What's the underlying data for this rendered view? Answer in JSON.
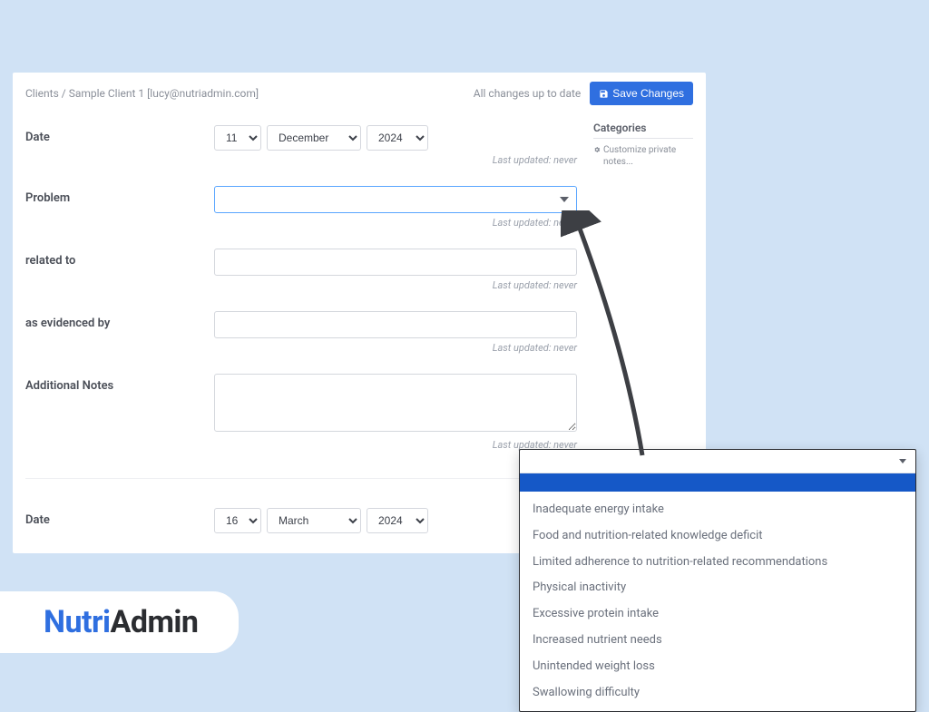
{
  "breadcrumb": {
    "root": "Clients",
    "sep": "/",
    "client": "Sample Client 1 [lucy@nutriadmin.com]"
  },
  "status": "All changes up to date",
  "save_label": "Save Changes",
  "sidebar": {
    "title": "Categories",
    "link": "Customize private notes..."
  },
  "fields": {
    "date1": {
      "label": "Date",
      "day": "11",
      "month": "December",
      "year": "2024",
      "updated": "Last updated: never"
    },
    "problem": {
      "label": "Problem",
      "value": "",
      "updated": "Last updated: never"
    },
    "related": {
      "label": "related to",
      "value": "",
      "updated": "Last updated: never"
    },
    "evidenced": {
      "label": "as evidenced by",
      "value": "",
      "updated": "Last updated: never"
    },
    "notes": {
      "label": "Additional Notes",
      "value": "",
      "updated": "Last updated: never"
    },
    "date2": {
      "label": "Date",
      "day": "16",
      "month": "March",
      "year": "2024"
    }
  },
  "dropdown": {
    "items": [
      "Inadequate energy intake",
      "Food and nutrition-related knowledge deficit",
      "Limited adherence to nutrition-related recommendations",
      "Physical inactivity",
      "Excessive protein intake",
      "Increased nutrient needs",
      "Unintended weight loss",
      "Swallowing difficulty"
    ]
  },
  "logo": {
    "part1": "Nutri",
    "part2": "Admin"
  }
}
